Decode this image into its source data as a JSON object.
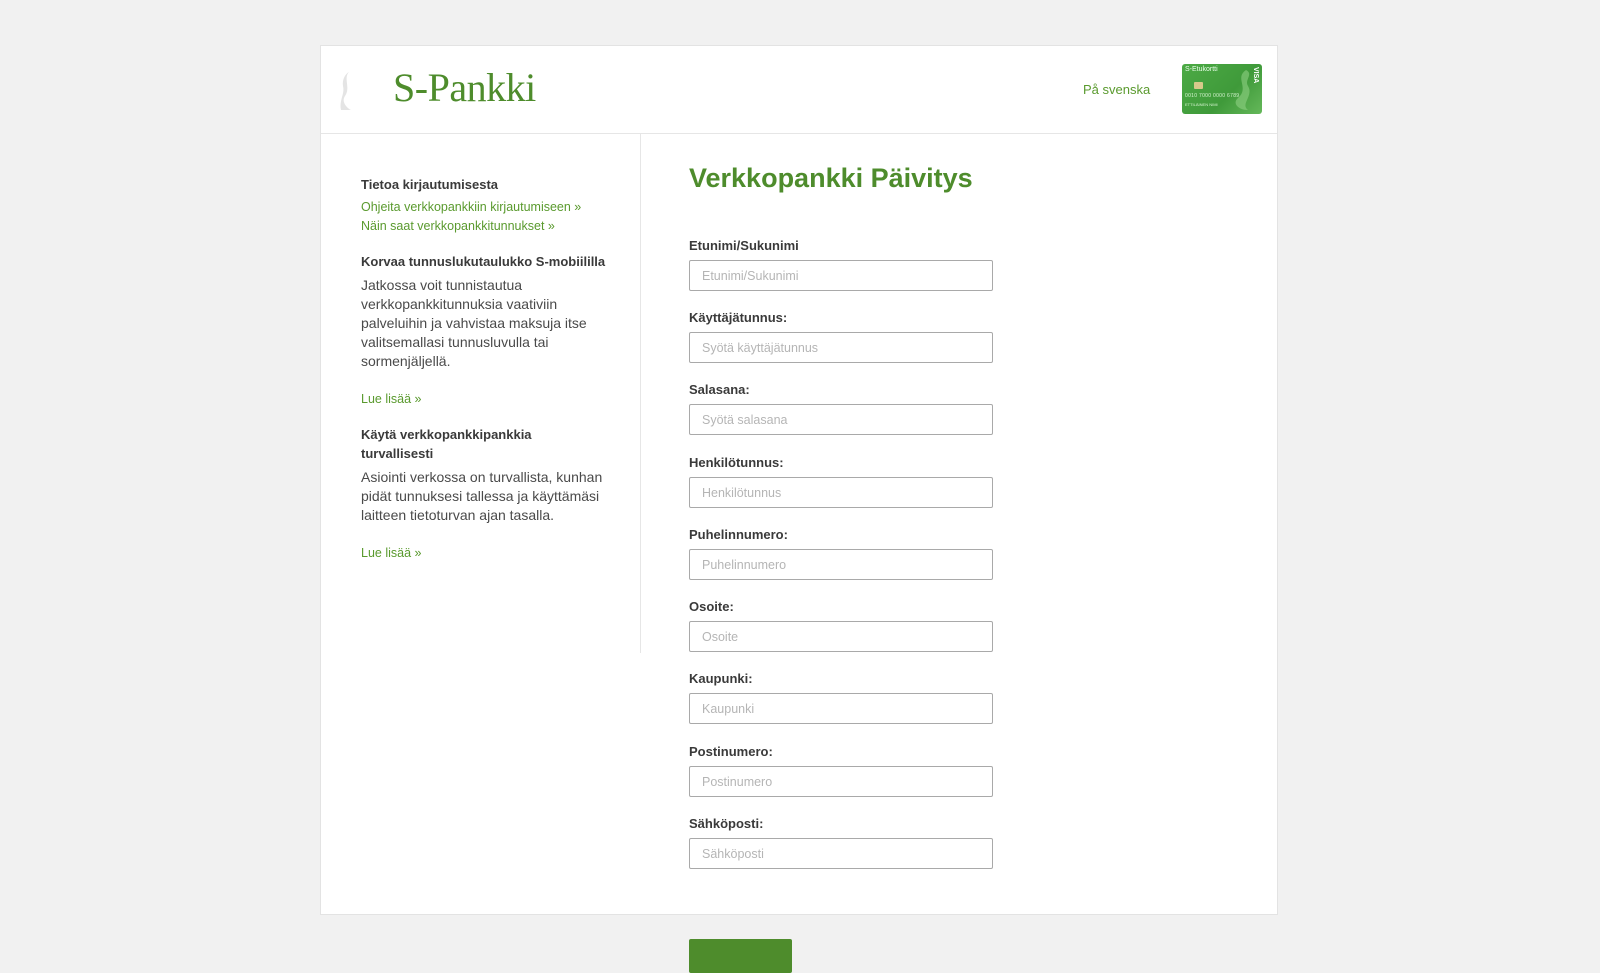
{
  "header": {
    "logo_text": "S-Pankki",
    "language_link": "På svenska",
    "card": {
      "title": "S-Etukortti",
      "brand": "VISA",
      "number": "0010 7000 0000 6789",
      "holder": "ETTILÄINEN NIMI"
    }
  },
  "sidebar": {
    "login_info": {
      "heading": "Tietoa kirjautumisesta",
      "links": [
        "Ohjeita verkkopankkiin kirjautumiseen »",
        "Näin saat verkkopankkitunnukset »"
      ]
    },
    "mobile_block": {
      "heading": "Korvaa tunnuslukutaulukko S-mobiililla",
      "text": "Jatkossa voit tunnistautua verkkopankkitunnuksia vaativiin palveluihin ja vahvistaa maksuja itse valitsemallasi tunnusluvulla tai sormenjäljellä.",
      "link": "Lue lisää »"
    },
    "security_block": {
      "heading": "Käytä verkkopankkipankkia turvallisesti",
      "text": "Asiointi verkossa on turvallista, kunhan pidät tunnuksesi tallessa ja käyttämäsi laitteen tietoturvan ajan tasalla.",
      "link": "Lue lisää »"
    }
  },
  "main": {
    "title": "Verkkopankki Päivitys",
    "fields": [
      {
        "label": "Etunimi/Sukunimi",
        "placeholder": "Etunimi/Sukunimi",
        "value": ""
      },
      {
        "label": "Käyttäjätunnus:",
        "placeholder": "Syötä käyttäjätunnus",
        "value": ""
      },
      {
        "label": "Salasana:",
        "placeholder": "Syötä salasana",
        "value": ""
      },
      {
        "label": "Henkilötunnus:",
        "placeholder": "Henkilötunnus",
        "value": ""
      },
      {
        "label": "Puhelinnumero:",
        "placeholder": "Puhelinnumero",
        "value": ""
      },
      {
        "label": "Osoite:",
        "placeholder": "Osoite",
        "value": ""
      },
      {
        "label": "Kaupunki:",
        "placeholder": "Kaupunki",
        "value": ""
      },
      {
        "label": "Postinumero:",
        "placeholder": "Postinumero",
        "value": ""
      },
      {
        "label": "Sähköposti:",
        "placeholder": "Sähköposti",
        "value": ""
      }
    ],
    "submit_label": ""
  },
  "colors": {
    "brand_green": "#4e8c2c",
    "link_green": "#5a9a2e",
    "page_background": "#f1f1f1",
    "input_border": "#a9a9a9"
  },
  "icons": {
    "logo_mark": "s-pankki-logo-mark-icon",
    "card": "s-etukortti-visa-card-icon"
  }
}
